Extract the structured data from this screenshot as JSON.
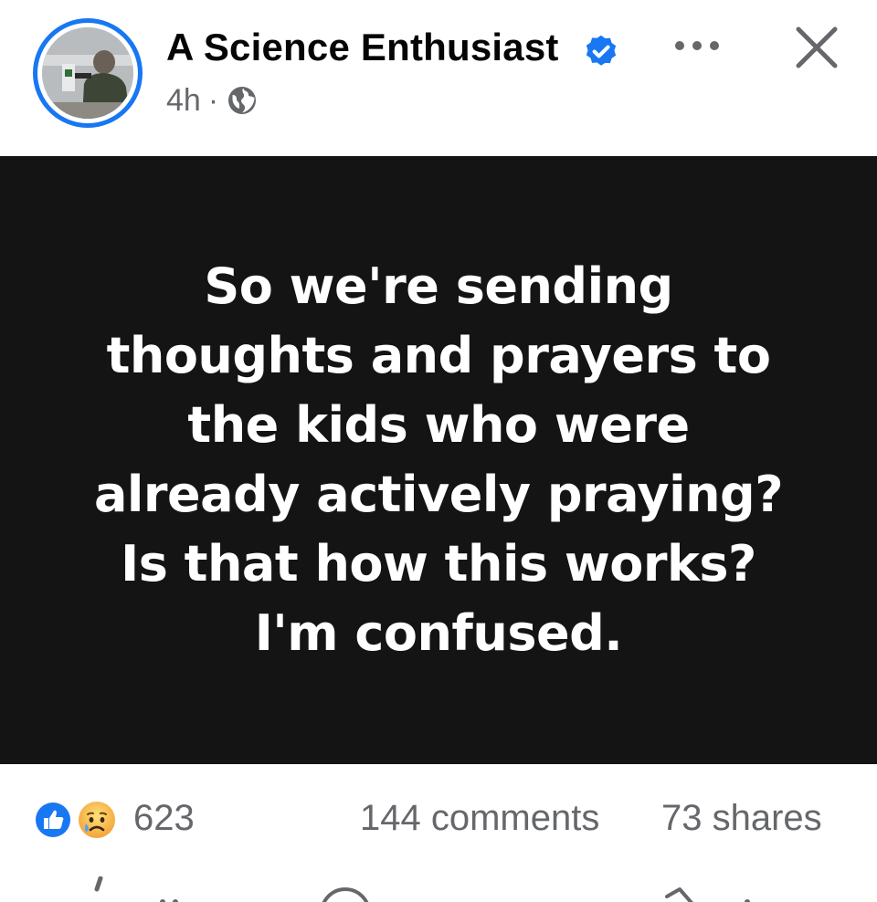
{
  "header": {
    "page_name": "A Science Enthusiast",
    "time": "4h",
    "separator": "·",
    "audience_icon": "globe-icon",
    "verified_icon": "verified-badge-icon",
    "more_icon": "more-horizontal-icon",
    "close_icon": "close-icon"
  },
  "post": {
    "text": "So we're sending\nthoughts and prayers to\nthe kids who were\nalready actively praying?\nIs that how this works?\nI'm confused.",
    "background": "#141414",
    "text_color": "#ffffff"
  },
  "stats": {
    "reactions": [
      "like-icon",
      "sad-face-icon"
    ],
    "reaction_count": "623",
    "comments": "144 comments",
    "shares": "73 shares"
  },
  "actions": {
    "items": [
      "like-button-icon",
      "comment-button-icon",
      "share-button-icon"
    ]
  },
  "colors": {
    "brand_blue": "#1877f2",
    "secondary_text": "#65676b",
    "primary_text": "#050505"
  }
}
